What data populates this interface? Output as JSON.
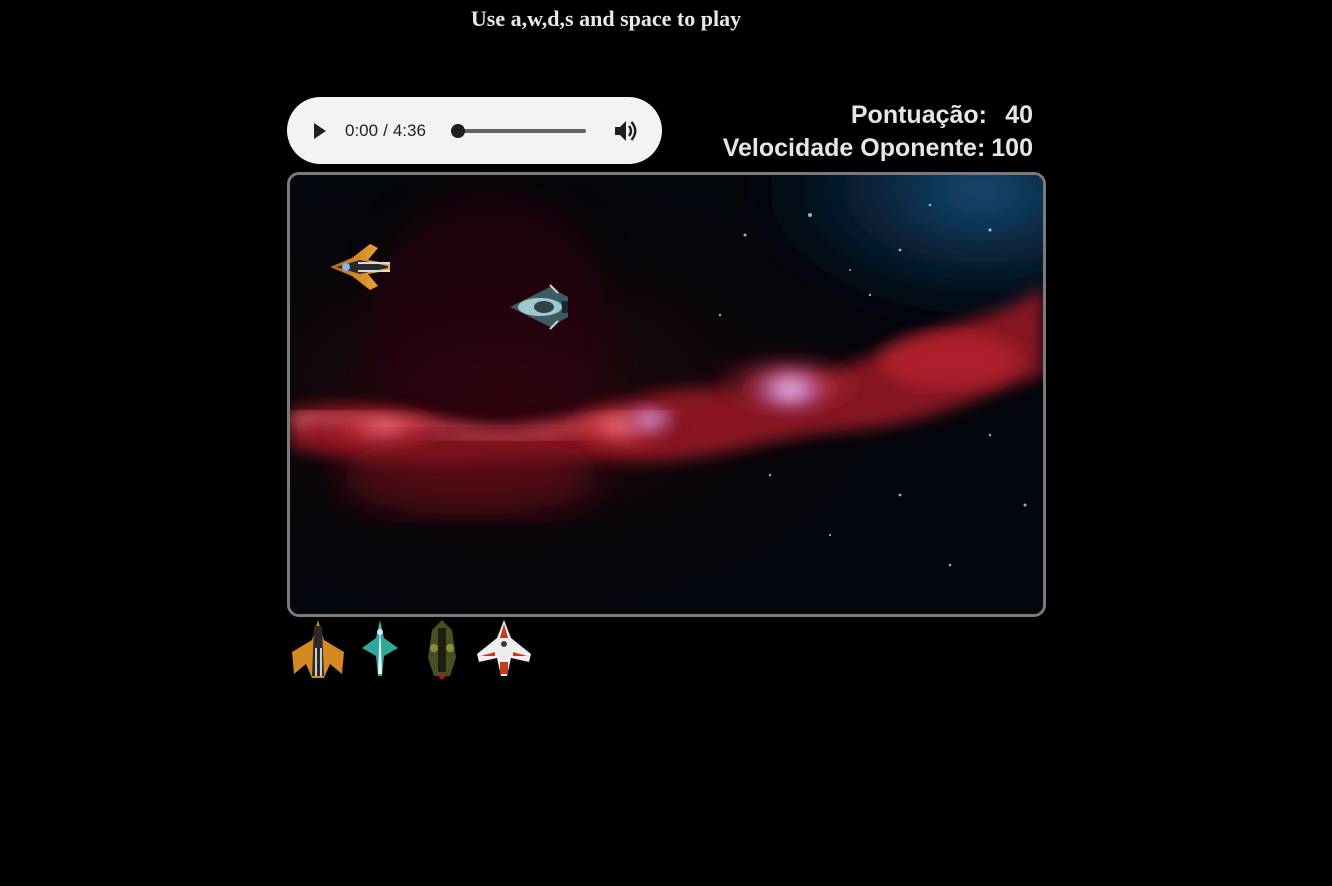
{
  "instructions": "Use a,w,d,s and space to play",
  "audio": {
    "current_time": "0:00",
    "separator": "/",
    "duration": "4:36",
    "progress": 0
  },
  "scoreboard": {
    "score_label": "Pontuação:",
    "score_value": "40",
    "speed_label": "Velocidade Oponente:",
    "speed_value": "100"
  },
  "game": {
    "background": "nebula-space",
    "player_ship": "orange-fighter-ship",
    "enemy_ship": "teal-enemy-ship"
  },
  "roster": [
    "orange-fighter-ship-icon",
    "teal-arrow-ship-icon",
    "olive-gunship-icon",
    "white-red-ship-icon"
  ]
}
